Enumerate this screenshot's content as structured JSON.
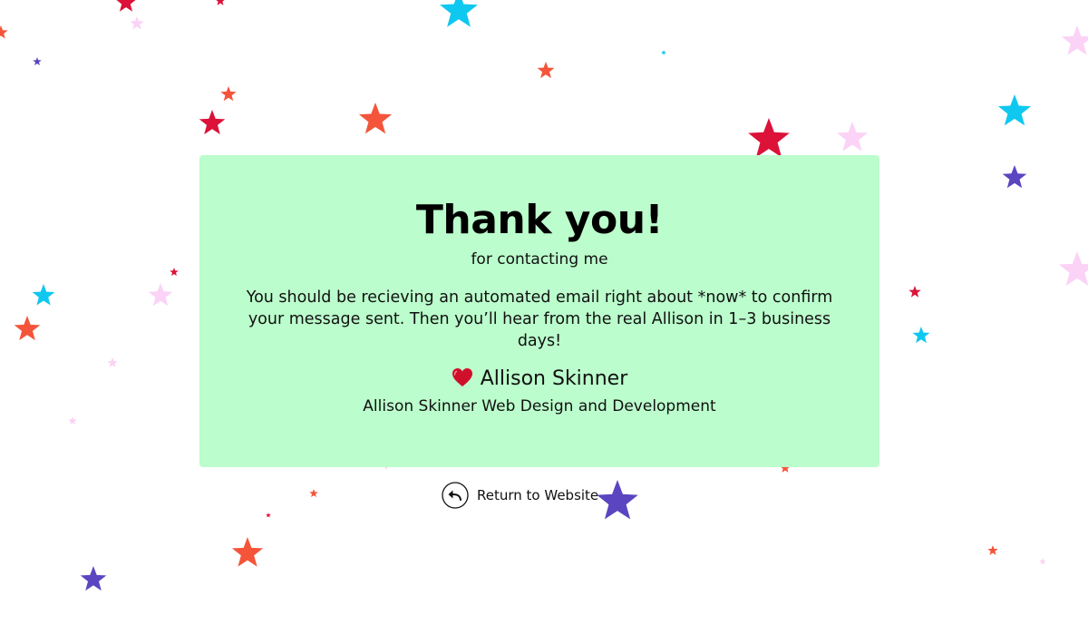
{
  "card": {
    "title": "Thank you!",
    "subtitle": "for contacting me",
    "message": "You should be recieving an automated email right about *now* to confirm your message sent. Then you’ll hear from the real Allison in 1–3 business days!",
    "signature_name": "Allison Skinner",
    "signature_icon": "heart-icon",
    "company": "Allison Skinner Web Design and Development"
  },
  "return_link": {
    "label": "Return to Website",
    "icon": "back-arrow-icon"
  },
  "colors": {
    "background": "#ffffff",
    "card_background": "#bbfdcc",
    "star_red": "#dc1238",
    "star_orange": "#f4553a",
    "star_cyan": "#0fc8f0",
    "star_purple": "#5b45c0",
    "star_pink": "#fbd3f6",
    "heart": "#d0102b"
  }
}
